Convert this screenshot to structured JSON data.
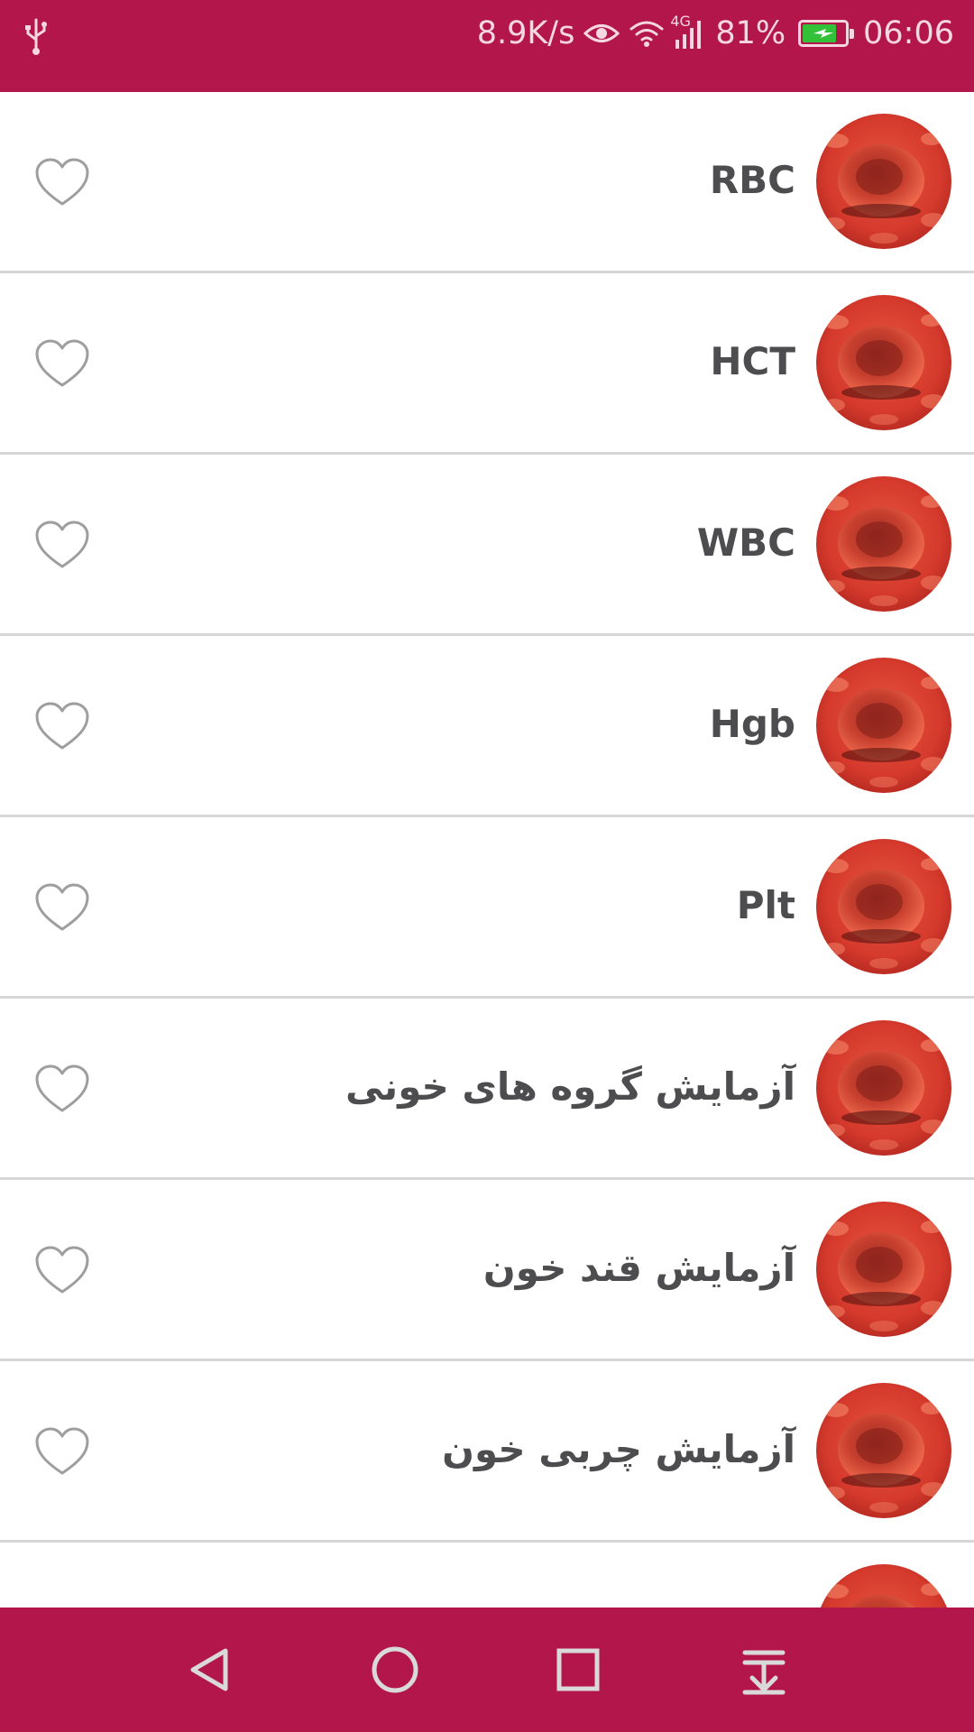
{
  "status_bar": {
    "network_speed": "8.9K/s",
    "network_type": "4G",
    "battery_percent": "81%",
    "battery_level": 0.81,
    "time": "06:06",
    "icons": [
      "usb-icon",
      "eye-icon",
      "wifi-icon",
      "signal-icon",
      "battery-icon"
    ]
  },
  "list": {
    "items": [
      {
        "label": "RBC",
        "favorite": false
      },
      {
        "label": "HCT",
        "favorite": false
      },
      {
        "label": "WBC",
        "favorite": false
      },
      {
        "label": "Hgb",
        "favorite": false
      },
      {
        "label": "Plt",
        "favorite": false
      },
      {
        "label": "آزمایش گروه های خونی",
        "favorite": false
      },
      {
        "label": "آزمایش قند خون",
        "favorite": false
      },
      {
        "label": "آزمایش چربی خون",
        "favorite": false
      }
    ]
  },
  "nav_bar": {
    "buttons": [
      "back-icon",
      "home-icon",
      "recents-icon",
      "notification-pull-icon"
    ]
  },
  "colors": {
    "primary": "#b2164b",
    "text": "#4d4d4f",
    "divider": "#d6d6d6",
    "heart_outline": "#9e9e9e"
  }
}
